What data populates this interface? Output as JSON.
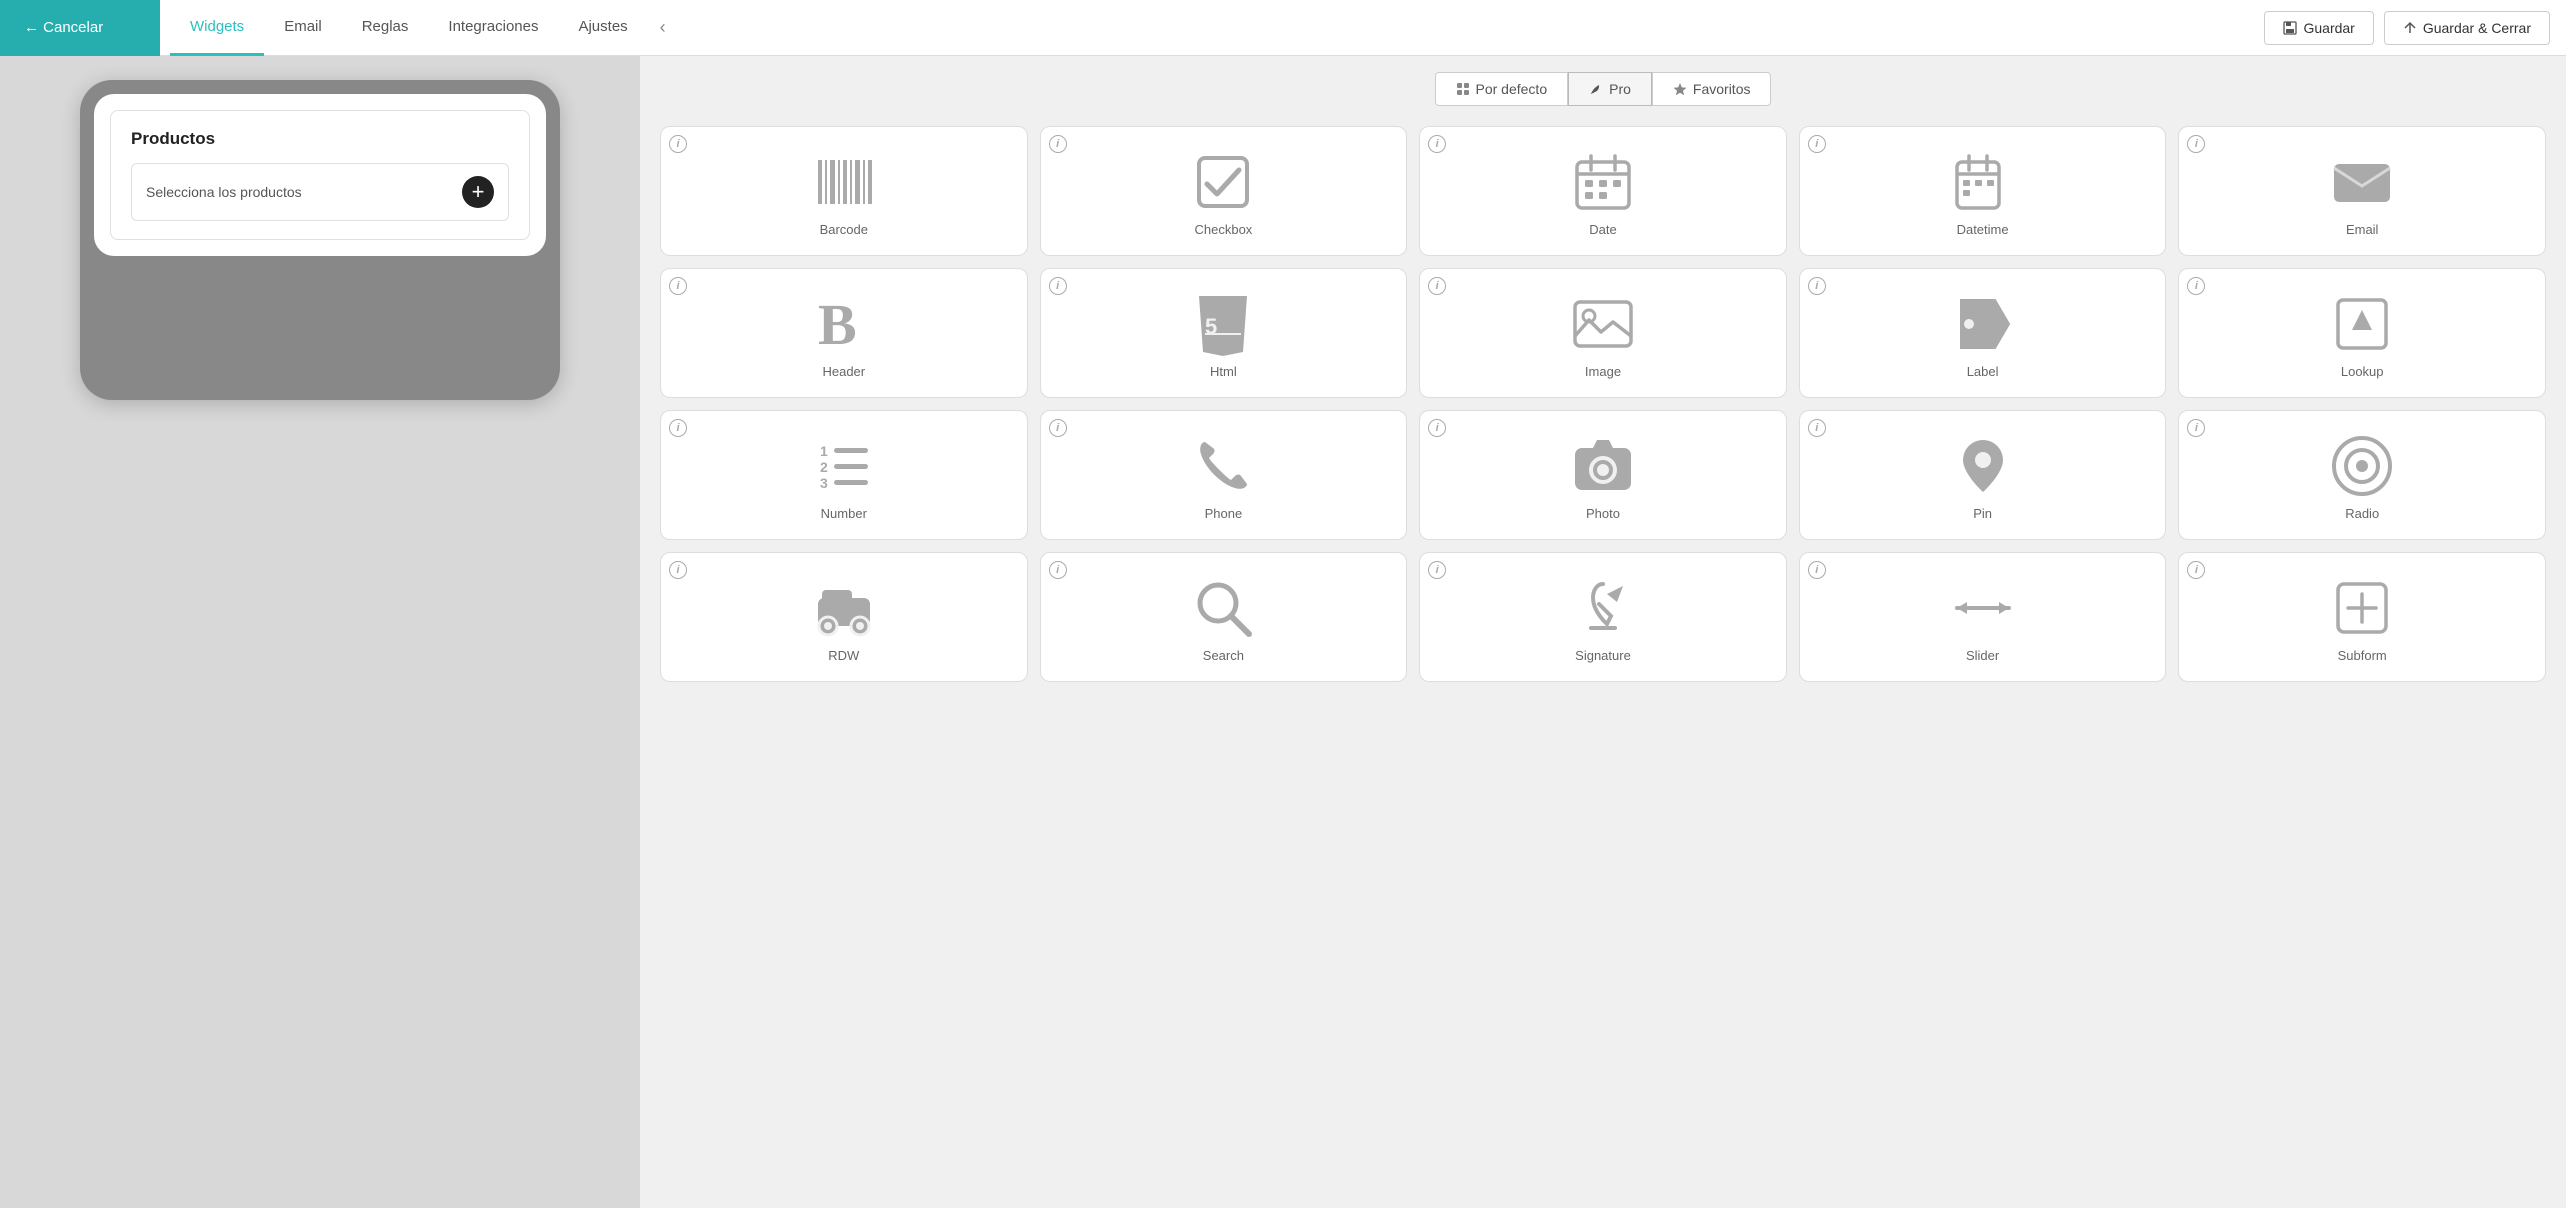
{
  "nav": {
    "cancel_label": "← Cancelar",
    "tabs": [
      "Widgets",
      "Email",
      "Reglas",
      "Integraciones",
      "Ajustes"
    ],
    "active_tab": "Widgets",
    "collapse_icon": "‹",
    "guardar_label": "Guardar",
    "guardar_cerrar_label": "Guardar & Cerrar"
  },
  "preview": {
    "card_title": "Productos",
    "field_label": "Selecciona los productos",
    "add_btn_label": "+"
  },
  "widget_panel": {
    "tabs": [
      {
        "id": "por-defecto",
        "label": "Por defecto",
        "icon": "grid"
      },
      {
        "id": "pro",
        "label": "Pro",
        "icon": "leaf"
      },
      {
        "id": "favoritos",
        "label": "Favoritos",
        "icon": "star"
      }
    ],
    "active_tab": "pro",
    "widgets": [
      {
        "id": "barcode",
        "label": "Barcode"
      },
      {
        "id": "checkbox",
        "label": "Checkbox"
      },
      {
        "id": "date",
        "label": "Date"
      },
      {
        "id": "datetime",
        "label": "Datetime"
      },
      {
        "id": "email",
        "label": "Email"
      },
      {
        "id": "header",
        "label": "Header"
      },
      {
        "id": "html",
        "label": "Html"
      },
      {
        "id": "image",
        "label": "Image"
      },
      {
        "id": "label",
        "label": "Label"
      },
      {
        "id": "lookup",
        "label": "Lookup"
      },
      {
        "id": "number",
        "label": "Number"
      },
      {
        "id": "phone",
        "label": "Phone"
      },
      {
        "id": "photo",
        "label": "Photo"
      },
      {
        "id": "pin",
        "label": "Pin"
      },
      {
        "id": "radio",
        "label": "Radio"
      },
      {
        "id": "rdw",
        "label": "RDW"
      },
      {
        "id": "search",
        "label": "Search"
      },
      {
        "id": "signature",
        "label": "Signature"
      },
      {
        "id": "slider",
        "label": "Slider"
      },
      {
        "id": "subform",
        "label": "Subform"
      }
    ]
  }
}
